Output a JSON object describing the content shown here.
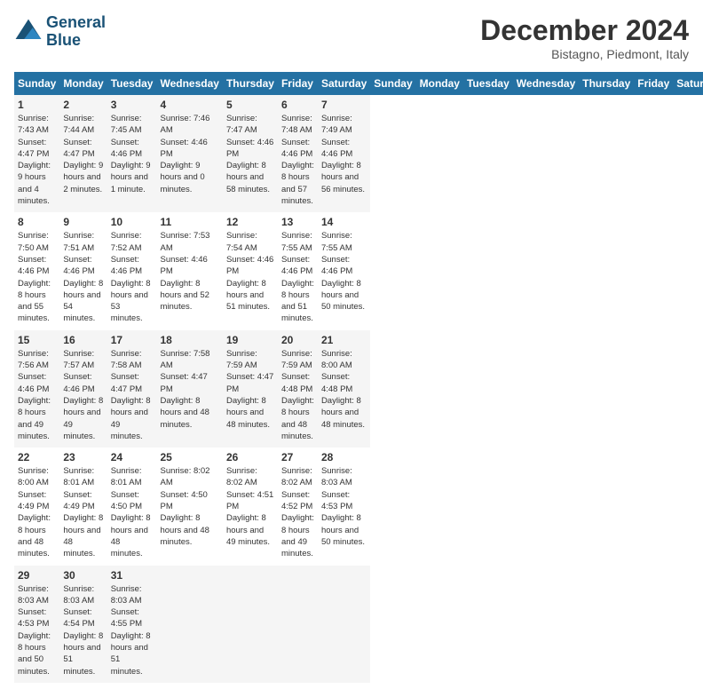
{
  "header": {
    "logo_line1": "General",
    "logo_line2": "Blue",
    "month": "December 2024",
    "location": "Bistagno, Piedmont, Italy"
  },
  "days_of_week": [
    "Sunday",
    "Monday",
    "Tuesday",
    "Wednesday",
    "Thursday",
    "Friday",
    "Saturday"
  ],
  "weeks": [
    [
      {
        "day": "1",
        "sunrise": "7:43 AM",
        "sunset": "4:47 PM",
        "daylight": "9 hours and 4 minutes."
      },
      {
        "day": "2",
        "sunrise": "7:44 AM",
        "sunset": "4:47 PM",
        "daylight": "9 hours and 2 minutes."
      },
      {
        "day": "3",
        "sunrise": "7:45 AM",
        "sunset": "4:46 PM",
        "daylight": "9 hours and 1 minute."
      },
      {
        "day": "4",
        "sunrise": "7:46 AM",
        "sunset": "4:46 PM",
        "daylight": "9 hours and 0 minutes."
      },
      {
        "day": "5",
        "sunrise": "7:47 AM",
        "sunset": "4:46 PM",
        "daylight": "8 hours and 58 minutes."
      },
      {
        "day": "6",
        "sunrise": "7:48 AM",
        "sunset": "4:46 PM",
        "daylight": "8 hours and 57 minutes."
      },
      {
        "day": "7",
        "sunrise": "7:49 AM",
        "sunset": "4:46 PM",
        "daylight": "8 hours and 56 minutes."
      }
    ],
    [
      {
        "day": "8",
        "sunrise": "7:50 AM",
        "sunset": "4:46 PM",
        "daylight": "8 hours and 55 minutes."
      },
      {
        "day": "9",
        "sunrise": "7:51 AM",
        "sunset": "4:46 PM",
        "daylight": "8 hours and 54 minutes."
      },
      {
        "day": "10",
        "sunrise": "7:52 AM",
        "sunset": "4:46 PM",
        "daylight": "8 hours and 53 minutes."
      },
      {
        "day": "11",
        "sunrise": "7:53 AM",
        "sunset": "4:46 PM",
        "daylight": "8 hours and 52 minutes."
      },
      {
        "day": "12",
        "sunrise": "7:54 AM",
        "sunset": "4:46 PM",
        "daylight": "8 hours and 51 minutes."
      },
      {
        "day": "13",
        "sunrise": "7:55 AM",
        "sunset": "4:46 PM",
        "daylight": "8 hours and 51 minutes."
      },
      {
        "day": "14",
        "sunrise": "7:55 AM",
        "sunset": "4:46 PM",
        "daylight": "8 hours and 50 minutes."
      }
    ],
    [
      {
        "day": "15",
        "sunrise": "7:56 AM",
        "sunset": "4:46 PM",
        "daylight": "8 hours and 49 minutes."
      },
      {
        "day": "16",
        "sunrise": "7:57 AM",
        "sunset": "4:46 PM",
        "daylight": "8 hours and 49 minutes."
      },
      {
        "day": "17",
        "sunrise": "7:58 AM",
        "sunset": "4:47 PM",
        "daylight": "8 hours and 49 minutes."
      },
      {
        "day": "18",
        "sunrise": "7:58 AM",
        "sunset": "4:47 PM",
        "daylight": "8 hours and 48 minutes."
      },
      {
        "day": "19",
        "sunrise": "7:59 AM",
        "sunset": "4:47 PM",
        "daylight": "8 hours and 48 minutes."
      },
      {
        "day": "20",
        "sunrise": "7:59 AM",
        "sunset": "4:48 PM",
        "daylight": "8 hours and 48 minutes."
      },
      {
        "day": "21",
        "sunrise": "8:00 AM",
        "sunset": "4:48 PM",
        "daylight": "8 hours and 48 minutes."
      }
    ],
    [
      {
        "day": "22",
        "sunrise": "8:00 AM",
        "sunset": "4:49 PM",
        "daylight": "8 hours and 48 minutes."
      },
      {
        "day": "23",
        "sunrise": "8:01 AM",
        "sunset": "4:49 PM",
        "daylight": "8 hours and 48 minutes."
      },
      {
        "day": "24",
        "sunrise": "8:01 AM",
        "sunset": "4:50 PM",
        "daylight": "8 hours and 48 minutes."
      },
      {
        "day": "25",
        "sunrise": "8:02 AM",
        "sunset": "4:50 PM",
        "daylight": "8 hours and 48 minutes."
      },
      {
        "day": "26",
        "sunrise": "8:02 AM",
        "sunset": "4:51 PM",
        "daylight": "8 hours and 49 minutes."
      },
      {
        "day": "27",
        "sunrise": "8:02 AM",
        "sunset": "4:52 PM",
        "daylight": "8 hours and 49 minutes."
      },
      {
        "day": "28",
        "sunrise": "8:03 AM",
        "sunset": "4:53 PM",
        "daylight": "8 hours and 50 minutes."
      }
    ],
    [
      {
        "day": "29",
        "sunrise": "8:03 AM",
        "sunset": "4:53 PM",
        "daylight": "8 hours and 50 minutes."
      },
      {
        "day": "30",
        "sunrise": "8:03 AM",
        "sunset": "4:54 PM",
        "daylight": "8 hours and 51 minutes."
      },
      {
        "day": "31",
        "sunrise": "8:03 AM",
        "sunset": "4:55 PM",
        "daylight": "8 hours and 51 minutes."
      },
      null,
      null,
      null,
      null
    ]
  ]
}
